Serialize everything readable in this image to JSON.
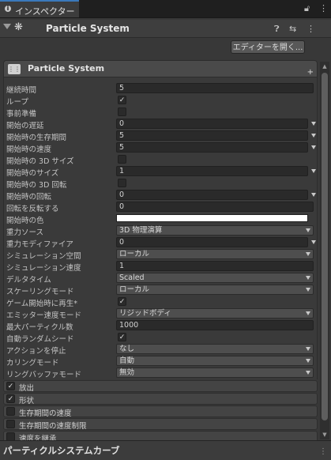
{
  "tab": {
    "title": "インスペクター",
    "lock_icon": "lock-icon",
    "menu_icon": "more-icon"
  },
  "component": {
    "title": "Particle System",
    "icons": [
      "fold-arrow-icon",
      "particle-system-icon",
      "help-icon",
      "settings-sliders-icon",
      "more-icon"
    ],
    "open_editor_label": "エディターを開く..."
  },
  "module": {
    "title": "Particle System",
    "add_icon": "plus-icon"
  },
  "rows": [
    {
      "label": "継続時間",
      "kind": "text",
      "value": "5"
    },
    {
      "label": "ループ",
      "kind": "check",
      "checked": true,
      "mark": "✓"
    },
    {
      "label": "事前準備",
      "kind": "check",
      "checked": false,
      "mark": ""
    },
    {
      "label": "開始の遅延",
      "kind": "num-dd",
      "value": "0"
    },
    {
      "label": "開始時の生存期間",
      "kind": "num-dd",
      "value": "5"
    },
    {
      "label": "開始時の速度",
      "kind": "num-dd",
      "value": "5"
    },
    {
      "label": "開始時の 3D サイズ",
      "kind": "check",
      "checked": false,
      "mark": ""
    },
    {
      "label": "開始時のサイズ",
      "kind": "num-dd",
      "value": "1"
    },
    {
      "label": "開始時の 3D 回転",
      "kind": "check",
      "checked": false,
      "mark": ""
    },
    {
      "label": "開始時の回転",
      "kind": "num-dd",
      "value": "0"
    },
    {
      "label": "回転を反転する",
      "kind": "text",
      "value": "0"
    },
    {
      "label": "開始時の色",
      "kind": "color",
      "color": "#ffffff"
    },
    {
      "label": "重力ソース",
      "kind": "dropdown",
      "value": "3D 物理演算"
    },
    {
      "label": "重力モディファイア",
      "kind": "num-dd",
      "value": "0"
    },
    {
      "label": "シミュレーション空間",
      "kind": "dropdown",
      "value": "ローカル"
    },
    {
      "label": "シミュレーション速度",
      "kind": "text",
      "value": "1"
    },
    {
      "label": "デルタタイム",
      "kind": "dropdown",
      "value": "Scaled"
    },
    {
      "label": "スケーリングモード",
      "kind": "dropdown",
      "value": "ローカル"
    },
    {
      "label": "ゲーム開始時に再生*",
      "kind": "check",
      "checked": true,
      "mark": "✓"
    },
    {
      "label": "エミッター速度モード",
      "kind": "dropdown",
      "value": "リジッドボディ"
    },
    {
      "label": "最大パーティクル数",
      "kind": "text",
      "value": "1000"
    },
    {
      "label": "自動ランダムシード",
      "kind": "check",
      "checked": true,
      "mark": "✓"
    },
    {
      "label": "アクションを停止",
      "kind": "dropdown",
      "value": "なし"
    },
    {
      "label": "カリングモード",
      "kind": "dropdown",
      "value": "自動"
    },
    {
      "label": "リングバッファモード",
      "kind": "dropdown",
      "value": "無効"
    }
  ],
  "submodules": [
    {
      "label": "放出",
      "checked": true,
      "mark": "✓"
    },
    {
      "label": "形状",
      "checked": true,
      "mark": "✓"
    },
    {
      "label": "生存期間の速度",
      "checked": false,
      "mark": ""
    },
    {
      "label": "生存期間の速度制限",
      "checked": false,
      "mark": ""
    },
    {
      "label": "速度を継承",
      "checked": false,
      "mark": ""
    }
  ],
  "footer": {
    "title": "パーティクルシステムカーブ",
    "grip_icon": "resize-grip-icon"
  }
}
